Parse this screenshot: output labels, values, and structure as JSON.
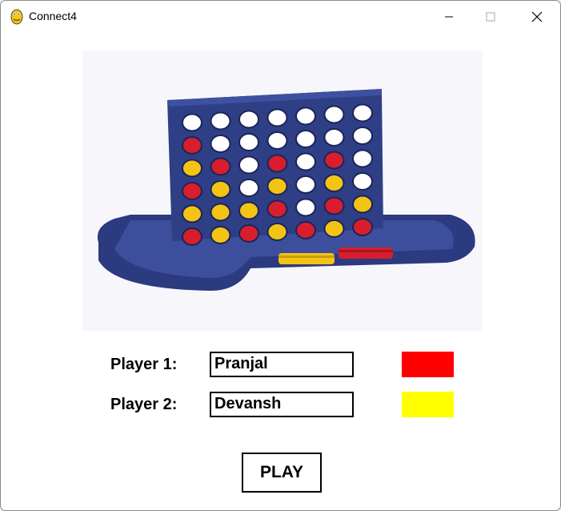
{
  "window": {
    "title": "Connect4",
    "icon": "pygame-snake-icon",
    "controls": [
      "minimize-icon",
      "maximize-icon",
      "close-icon"
    ]
  },
  "hero_image": {
    "subject": "connect-four-board",
    "board_colors": {
      "frame": "#2f3f86",
      "red": "#d81e2c",
      "yellow": "#f3c414"
    }
  },
  "players": [
    {
      "label": "Player 1:",
      "name": "Pranjal",
      "color": "#ff0000"
    },
    {
      "label": "Player 2:",
      "name": "Devansh",
      "color": "#ffff00"
    }
  ],
  "play_button": {
    "label": "PLAY"
  }
}
